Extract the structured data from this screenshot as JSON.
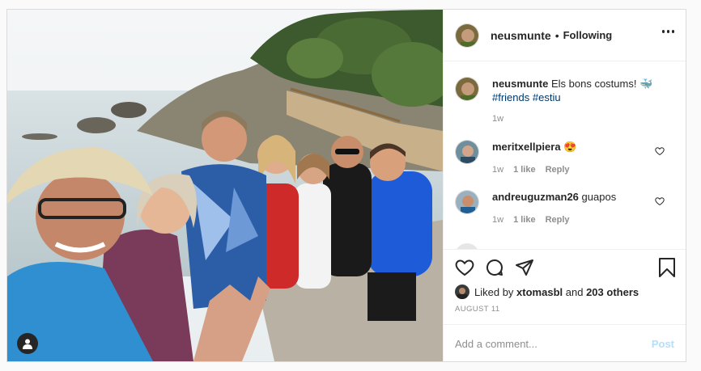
{
  "post": {
    "username": "neusmunte",
    "separator": "•",
    "follow_status": "Following",
    "caption_text": "Els bons costums! 🐳",
    "hashtags": [
      "#friends",
      "#estiu"
    ],
    "caption_time": "1w",
    "likes_prefix": "Liked by",
    "liked_by_user": "xtomasbl",
    "likes_and": "and",
    "likes_others": "203 others",
    "date": "AUGUST 11",
    "add_comment_placeholder": "Add a comment...",
    "post_label": "Post"
  },
  "comments": [
    {
      "username": "meritxellpiera",
      "text": "😍",
      "time": "1w",
      "likes": "1 like",
      "reply": "Reply"
    },
    {
      "username": "andreuguzman26",
      "text": "guapos",
      "time": "1w",
      "likes": "1 like",
      "reply": "Reply"
    }
  ],
  "icons": {
    "more": "more-options-icon",
    "like": "heart-icon",
    "comment": "comment-icon",
    "share": "paper-plane-icon",
    "save": "bookmark-icon",
    "tag": "user-tag-icon"
  }
}
